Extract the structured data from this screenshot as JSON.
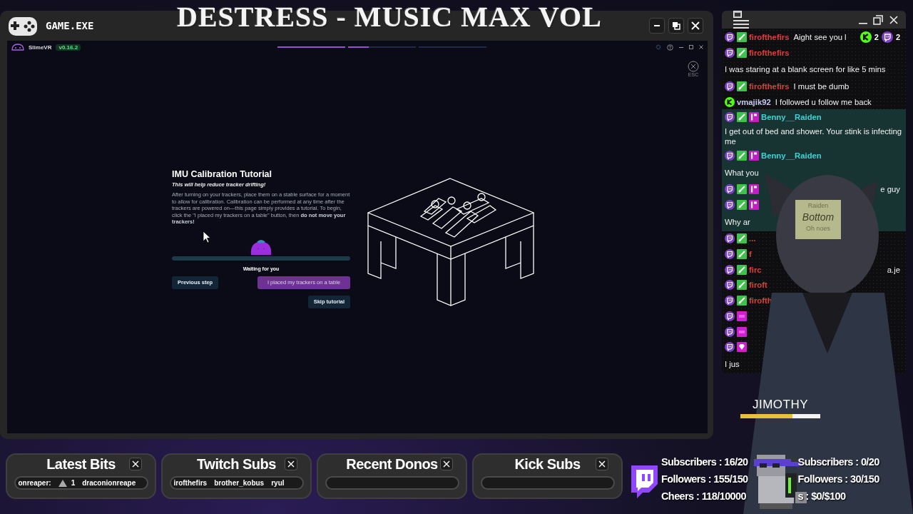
{
  "stream_title": "DESTRESS - MUSIC MAX VOL",
  "game_window": {
    "title": "GAME.EXE"
  },
  "app": {
    "name": "SlimeVR",
    "version": "v0.16.2",
    "close_hint": "ESC",
    "steps": [
      {
        "level": 1
      },
      {
        "level": 0.3
      },
      {
        "level": 0
      }
    ],
    "tutorial": {
      "title": "IMU Calibration Tutorial",
      "subtitle": "This will help reduce tracker drifting!",
      "body": "After turning on your trackers, place them on a stable surface for a moment to allow for calibration. Calibration can be performed at any time after the trackers are powered on—this page simply provides a tutorial. To begin, click the \"I placed my trackers on a table\" button, then **do not move your trackers!**",
      "status": "Waiting for you",
      "buttons": [
        {
          "label": "Previous step",
          "kind": "secondary"
        },
        {
          "label": "I placed my trackers on a table",
          "kind": "primary"
        },
        {
          "label": "Skip tutorial",
          "kind": "secondary"
        }
      ]
    }
  },
  "chat": {
    "counts": [
      {
        "kind": "kick",
        "text": "2"
      },
      {
        "kind": "twitch",
        "text": "2"
      }
    ],
    "lines": [
      {
        "badges": [
          {
            "kind": "twitch"
          },
          {
            "kind": "sword"
          }
        ],
        "user": "firofthefirs",
        "color": "#d8403c",
        "text": "Aight see you l",
        "highlighted": false
      },
      {
        "badges": [
          {
            "kind": "twitch"
          },
          {
            "kind": "sword"
          }
        ],
        "user": "firofthefirs",
        "color": "#d8403c",
        "highlighted": false
      },
      {
        "text": "I was staring at a blank screen for like 5 mins",
        "highlighted": false
      },
      {
        "badges": [
          {
            "kind": "twitch"
          },
          {
            "kind": "sword"
          }
        ],
        "user": "firofthefirs",
        "color": "#d8403c",
        "text": "I must be dumb",
        "highlighted": false
      },
      {
        "badges": [
          {
            "kind": "kick"
          }
        ],
        "user": "vmajik92",
        "color": "#c8c8f0",
        "text": "I followed u follow me back",
        "highlighted": false
      },
      {
        "badges": [
          {
            "kind": "twitch"
          },
          {
            "kind": "sword"
          },
          {
            "kind": "first"
          }
        ],
        "user": "Benny__Raiden",
        "color": "#3fd1d6",
        "highlighted": true
      },
      {
        "text": "I get out of bed and shower. Your stink is infecting me",
        "highlighted": true
      },
      {
        "badges": [
          {
            "kind": "twitch"
          },
          {
            "kind": "sword"
          },
          {
            "kind": "first"
          }
        ],
        "user": "Benny__Raiden",
        "color": "#3fd1d6",
        "highlighted": true
      },
      {
        "text": "What you",
        "highlighted": true
      },
      {
        "badges": [
          {
            "kind": "twitch"
          },
          {
            "kind": "sword"
          },
          {
            "kind": "first"
          }
        ],
        "tail": "e guy",
        "highlighted": true
      },
      {
        "badges": [
          {
            "kind": "twitch"
          },
          {
            "kind": "sword"
          },
          {
            "kind": "first"
          }
        ],
        "highlighted": true
      },
      {
        "text": "Why ar",
        "highlighted": true
      },
      {
        "badges": [
          {
            "kind": "twitch"
          },
          {
            "kind": "sword"
          }
        ],
        "user": "...",
        "color": "#d8403c",
        "highlighted": false
      },
      {
        "badges": [
          {
            "kind": "twitch"
          },
          {
            "kind": "sword"
          }
        ],
        "user": "f",
        "color": "#d8403c",
        "highlighted": false
      },
      {
        "badges": [
          {
            "kind": "twitch"
          },
          {
            "kind": "sword"
          }
        ],
        "user": "firc",
        "color": "#d8403c",
        "tail": "a.je",
        "highlighted": false
      },
      {
        "badges": [
          {
            "kind": "twitch"
          },
          {
            "kind": "sword"
          }
        ],
        "user": "firoft",
        "color": "#d8403c",
        "highlighted": false
      },
      {
        "badges": [
          {
            "kind": "twitch"
          },
          {
            "kind": "sword"
          }
        ],
        "user": "firofth",
        "color": "#d8403c",
        "highlighted": false
      },
      {
        "badges": [
          {
            "kind": "twitch"
          },
          {
            "kind": "sub"
          }
        ],
        "highlighted": false
      },
      {
        "badges": [
          {
            "kind": "twitch"
          },
          {
            "kind": "sub"
          }
        ],
        "highlighted": false
      },
      {
        "badges": [
          {
            "kind": "twitch"
          },
          {
            "kind": "gem"
          }
        ],
        "highlighted": false
      },
      {
        "text": "I jus",
        "highlighted": false
      }
    ]
  },
  "avatar": {
    "name": "JIMOTHY",
    "level": 0.65,
    "note": [
      "Raiden",
      "Bottom",
      "Oh noes"
    ]
  },
  "widgets": [
    {
      "title": "Latest Bits",
      "items": [
        {
          "kind": "text",
          "text": "onreaper:"
        },
        {
          "kind": "bits",
          "text": "1"
        },
        {
          "kind": "text",
          "text": "draconionreape"
        }
      ]
    },
    {
      "title": "Twitch Subs",
      "items": [
        {
          "kind": "text",
          "text": "irofthefirs"
        },
        {
          "kind": "text",
          "text": "brother_kobus"
        },
        {
          "kind": "text",
          "text": "ryul"
        }
      ]
    },
    {
      "title": "Recent Donos"
    },
    {
      "title": "Kick Subs"
    }
  ],
  "stats": {
    "left": [
      "Subscribers : 16/20",
      "Followers : 155/150",
      "Cheers : 118/10000"
    ],
    "right": [
      "Subscribers : 0/20",
      "Followers : 30/150",
      "s : $0/$100"
    ]
  }
}
